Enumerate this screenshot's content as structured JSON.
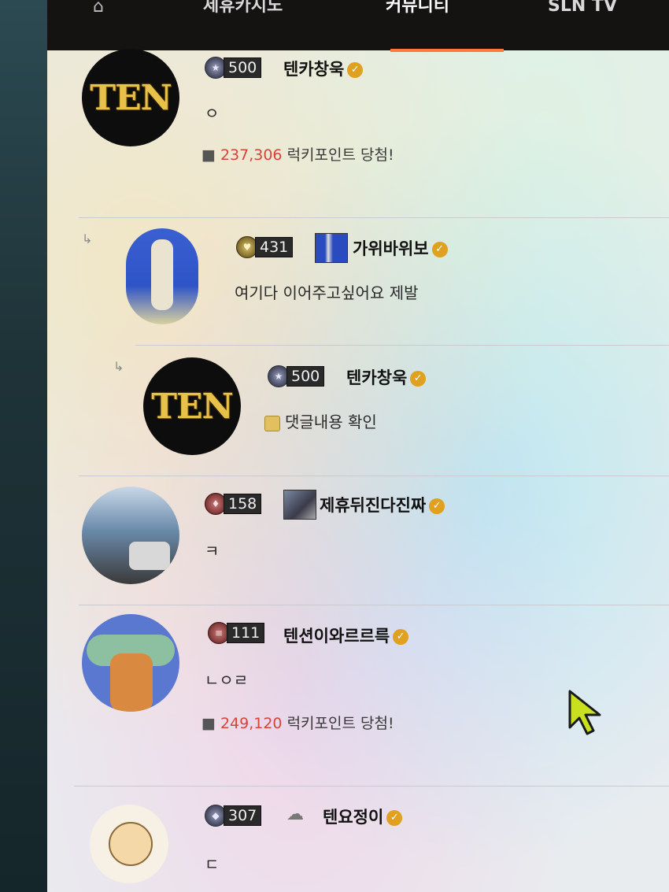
{
  "nav": {
    "home_icon": "home-icon",
    "items": [
      "제휴카지노",
      "커뮤니티",
      "SLN TV"
    ],
    "active_index": 1
  },
  "avatar_text": "TEN",
  "comments": [
    {
      "level": "500",
      "nickname": "텐카창욱",
      "text": "ㅇ",
      "prize_amount": "237,306",
      "prize_label": "럭키포인트 당첨!"
    },
    {
      "level": "431",
      "nickname": "가위바위보",
      "text": "여기다 이어주고싶어요 제발"
    },
    {
      "level": "500",
      "nickname": "텐카창욱",
      "text": "댓글내용 확인"
    },
    {
      "level": "158",
      "nickname": "제휴뒤진다진짜",
      "text": "ㅋ"
    },
    {
      "level": "111",
      "nickname": "텐션이와르르륵",
      "text": "ㄴㅇㄹ",
      "prize_amount": "249,120",
      "prize_label": "럭키포인트 당첨!"
    },
    {
      "level": "307",
      "nickname": "텐요정이",
      "text": "ㄷ"
    }
  ],
  "colors": {
    "accent": "#ff7a3a",
    "prize": "#d8433a",
    "verified": "#e0a020"
  }
}
